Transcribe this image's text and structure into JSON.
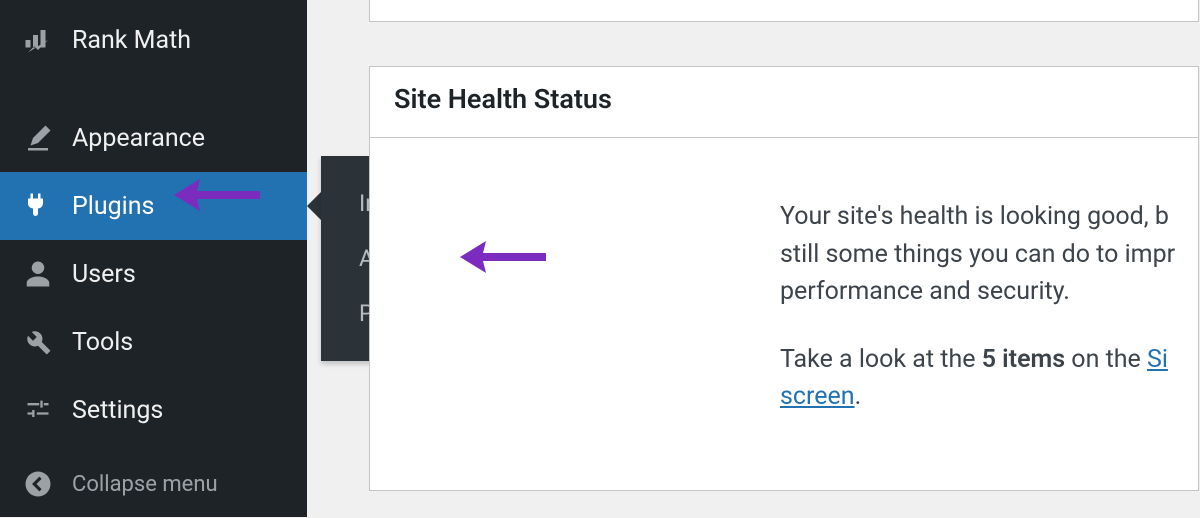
{
  "sidebar": {
    "items": [
      {
        "label": "Rank Math",
        "icon": "rankmath"
      },
      {
        "label": "Appearance",
        "icon": "appearance"
      },
      {
        "label": "Plugins",
        "icon": "plugins",
        "active": true
      },
      {
        "label": "Users",
        "icon": "users"
      },
      {
        "label": "Tools",
        "icon": "tools"
      },
      {
        "label": "Settings",
        "icon": "settings"
      }
    ],
    "collapse_label": "Collapse menu"
  },
  "submenu": {
    "items": [
      {
        "label": "Installed Plugins"
      },
      {
        "label": "Add New"
      },
      {
        "label": "Plugin Editor"
      }
    ]
  },
  "panel": {
    "title": "Site Health Status",
    "body_p1_a": "Your site's health is looking good, b",
    "body_p1_b": "still some things you can do to impr",
    "body_p1_c": "performance and security.",
    "body_p2_a": "Take a look at the ",
    "body_p2_strong": "5 items",
    "body_p2_b": " on the ",
    "body_p2_link1": "Si",
    "body_p2_link2": "screen",
    "body_p2_c": "."
  }
}
